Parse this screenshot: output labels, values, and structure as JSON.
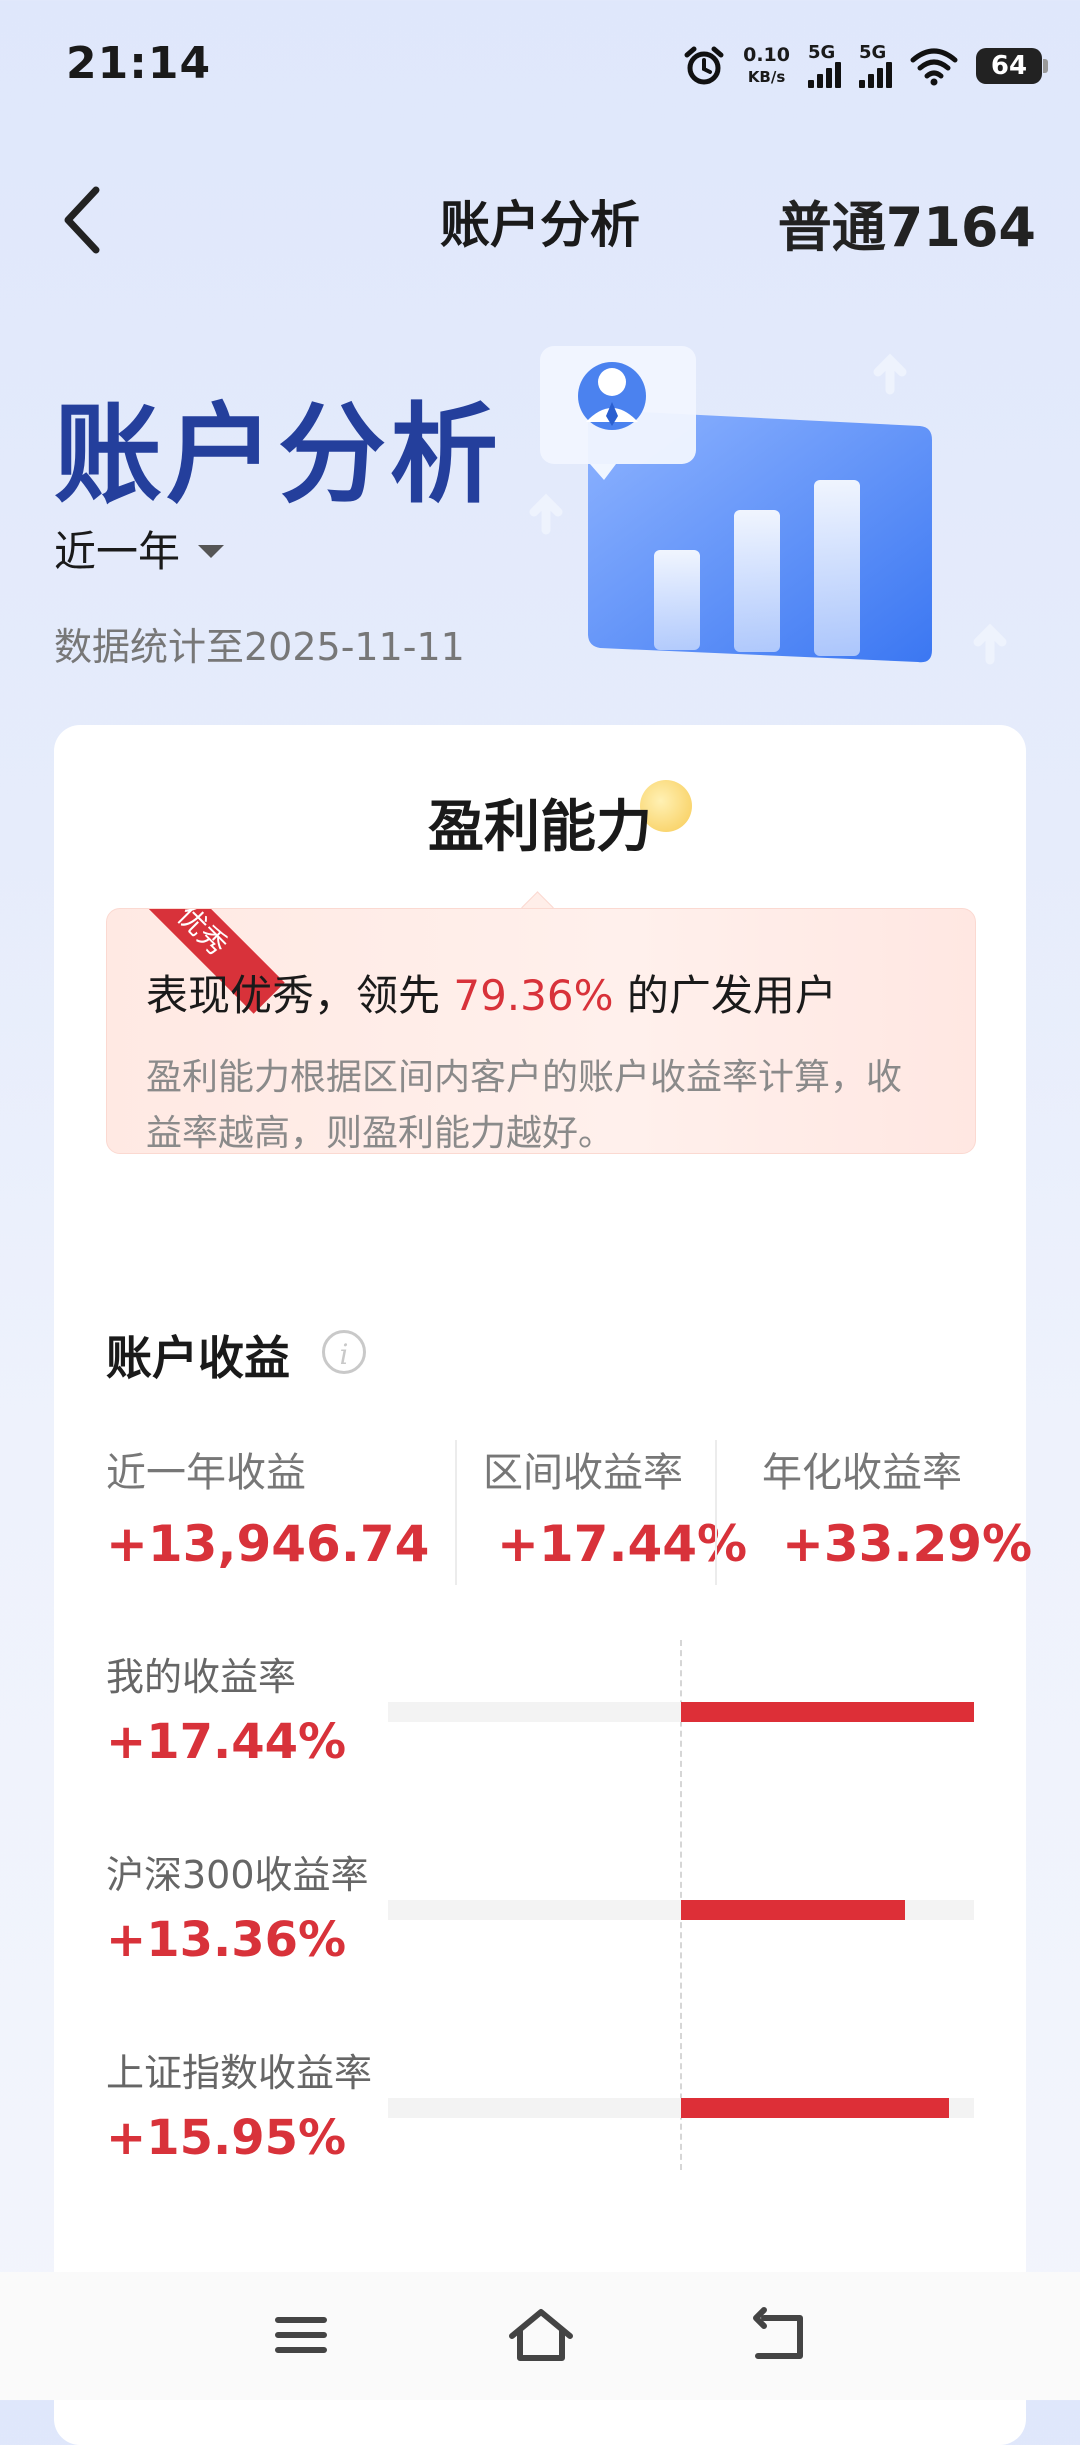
{
  "status_bar": {
    "time": "21:14",
    "net_speed_value": "0.10",
    "net_speed_unit": "KB/s",
    "sim1_label": "5G",
    "sim2_label": "5G",
    "battery": "64",
    "icons": [
      "alarm-icon",
      "signal-icon",
      "signal-icon",
      "wifi-icon",
      "battery-icon"
    ]
  },
  "nav": {
    "back_icon": "chevron-left-icon",
    "title": "账户分析",
    "account": "普通7164"
  },
  "hero": {
    "title": "账户分析",
    "period": "近一年",
    "data_date": "数据统计至2025-11-11"
  },
  "profitability": {
    "title": "盈利能力",
    "badge": "优秀",
    "summary_prefix": "表现优秀，领先 ",
    "percent": "79.36%",
    "summary_suffix": " 的广发用户",
    "description": "盈利能力根据区间内客户的账户收益率计算，收益率越高，则盈利能力越好。"
  },
  "income": {
    "title": "账户收益",
    "stats": [
      {
        "label": "近一年收益",
        "value": "+13,946.74"
      },
      {
        "label": "区间收益率",
        "value": "+17.44%"
      },
      {
        "label": "年化收益率",
        "value": "+33.29%"
      }
    ],
    "comparisons": [
      {
        "label": "我的收益率",
        "value": "+17.44%",
        "rate": 17.44
      },
      {
        "label": "沪深300收益率",
        "value": "+13.36%",
        "rate": 13.36
      },
      {
        "label": "上证指数收益率",
        "value": "+15.95%",
        "rate": 15.95
      }
    ]
  },
  "bottom_nav": {
    "icons": [
      "menu-icon",
      "home-icon",
      "back-icon"
    ]
  },
  "colors": {
    "accent_red": "#d8323a",
    "hero_blue": "#243f9c"
  }
}
